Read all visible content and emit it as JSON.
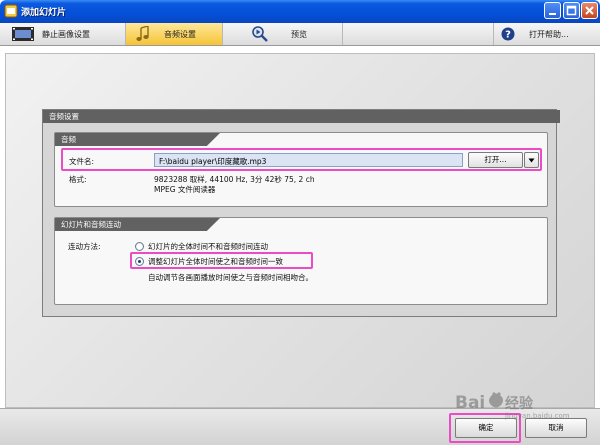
{
  "window": {
    "title": "添加幻灯片",
    "colors": {
      "titlebar": "#0550d8",
      "active_tab": "#f5c437",
      "highlight": "#ec4bc5"
    }
  },
  "toolbar": {
    "items": [
      {
        "label": "静止画像设置",
        "icon": "film-strip-icon"
      },
      {
        "label": "音频设置",
        "icon": "music-note-icon",
        "active": true
      },
      {
        "label": "预览",
        "icon": "magnifier-play-icon"
      },
      {
        "label": "打开帮助...",
        "icon": "help-icon"
      }
    ]
  },
  "audio_settings": {
    "header": "音频设置",
    "audio_group": {
      "title": "音频",
      "file_label": "文件名:",
      "file_value": "F:\\baidu player\\印度藏歌.mp3",
      "open_button": "打开...",
      "dropdown_icon": "dropdown-arrow-icon",
      "format_label": "格式:",
      "format_line1": "9823288 取样, 44100 Hz, 3分 42秒 75, 2 ch",
      "format_line2": "MPEG 文件阅读器"
    },
    "link_group": {
      "title": "幻灯片和音频连动",
      "method_label": "连动方法:",
      "option1": "幻灯片的全体时间不和音频时间连动",
      "option2": "调整幻灯片全体时间使之和音频时间一致",
      "selected": 2,
      "description": "自动调节各画面播放时间使之与音频时间相吻合。"
    }
  },
  "footer": {
    "ok": "确定",
    "cancel": "取消"
  },
  "watermark": {
    "text": "Bai",
    "text2": "经验",
    "url": "jingyan.baidu.com"
  }
}
